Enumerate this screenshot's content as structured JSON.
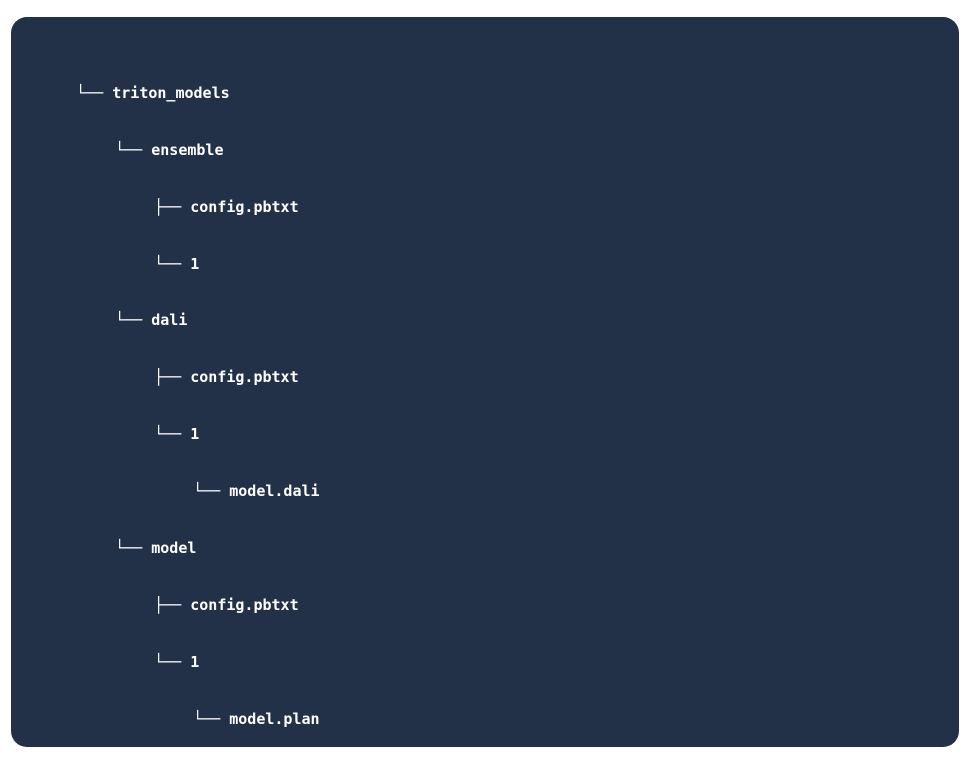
{
  "tree": [
    {
      "depth": 0,
      "branch": "└──",
      "name": "triton_models"
    },
    {
      "depth": 1,
      "branch": "└──",
      "name": "ensemble"
    },
    {
      "depth": 2,
      "branch": "├──",
      "name": "config.pbtxt"
    },
    {
      "depth": 2,
      "branch": "└──",
      "name": "1"
    },
    {
      "depth": 1,
      "branch": "└──",
      "name": "dali"
    },
    {
      "depth": 2,
      "branch": "├──",
      "name": "config.pbtxt"
    },
    {
      "depth": 2,
      "branch": "└──",
      "name": "1"
    },
    {
      "depth": 3,
      "branch": "└──",
      "name": "model.dali"
    },
    {
      "depth": 1,
      "branch": "└──",
      "name": "model"
    },
    {
      "depth": 2,
      "branch": "├──",
      "name": "config.pbtxt"
    },
    {
      "depth": 2,
      "branch": "└──",
      "name": "1"
    },
    {
      "depth": 3,
      "branch": "└──",
      "name": "model.plan"
    }
  ]
}
